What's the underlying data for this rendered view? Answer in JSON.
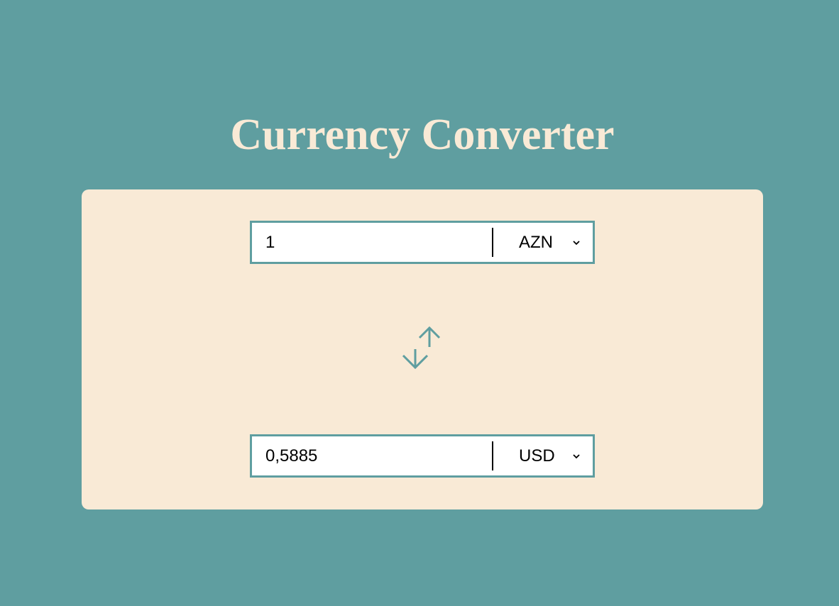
{
  "app": {
    "title": "Currency Converter"
  },
  "from": {
    "amount": "1",
    "currency": "AZN"
  },
  "to": {
    "amount": "0,5885",
    "currency": "USD"
  },
  "icons": {
    "swap": "swap-arrows-icon",
    "dropdown": "chevron-down-icon"
  },
  "colors": {
    "background": "#5f9ea0",
    "card": "#f9ead6",
    "accent": "#5f9ea0"
  }
}
